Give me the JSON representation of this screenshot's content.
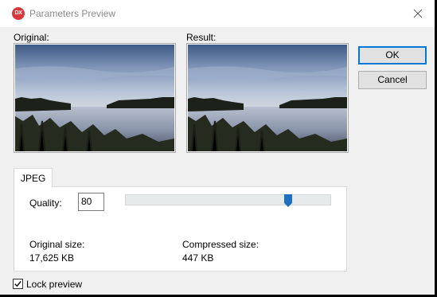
{
  "window": {
    "title": "Parameters Preview",
    "icon": "dx-app-icon",
    "icon_text": "DX"
  },
  "preview": {
    "original_label": "Original:",
    "result_label": "Result:"
  },
  "buttons": {
    "ok_label": "OK",
    "cancel_label": "Cancel"
  },
  "tabs": [
    {
      "label": "JPEG",
      "selected": true
    }
  ],
  "jpeg": {
    "quality_label": "Quality:",
    "quality_value": "80",
    "slider_level_fraction": 0.8,
    "original_size_label": "Original size:",
    "original_size_value": "17,625 KB",
    "compressed_size_label": "Compressed size:",
    "compressed_size_value": "447 KB"
  },
  "lock_preview": {
    "label": "Lock preview",
    "checked": true
  },
  "colors": {
    "accent": "#0078d7",
    "slider_thumb": "#1f6fc0",
    "app_icon": "#d9383a"
  }
}
